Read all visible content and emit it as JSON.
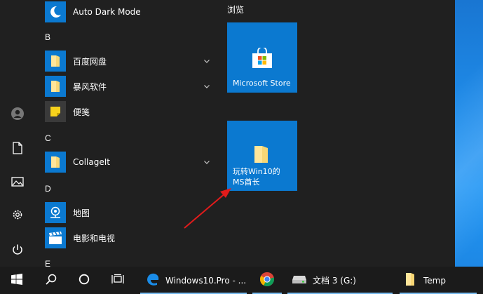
{
  "start_menu": {
    "apps": [
      {
        "type": "app",
        "label": "Auto Dark Mode",
        "icon": "moon-icon"
      },
      {
        "type": "letter",
        "label": "B"
      },
      {
        "type": "app",
        "label": "百度网盘",
        "icon": "folder-icon",
        "expandable": true
      },
      {
        "type": "app",
        "label": "暴风软件",
        "icon": "folder-icon",
        "expandable": true
      },
      {
        "type": "app",
        "label": "便笺",
        "icon": "sticky-note-icon"
      },
      {
        "type": "letter",
        "label": "C"
      },
      {
        "type": "app",
        "label": "CollageIt",
        "icon": "folder-icon",
        "expandable": true
      },
      {
        "type": "letter",
        "label": "D"
      },
      {
        "type": "app",
        "label": "地图",
        "icon": "maps-icon"
      },
      {
        "type": "app",
        "label": "电影和电视",
        "icon": "movies-icon"
      },
      {
        "type": "letter",
        "label": "E"
      }
    ],
    "tiles_group_title": "浏览",
    "tiles": [
      {
        "label_lines": [
          "Microsoft Store"
        ],
        "icon": "store-icon"
      },
      {
        "label_lines": [
          "玩转Win10的",
          "MS酋长"
        ],
        "icon": "folder-icon"
      }
    ],
    "rail": [
      "user-icon",
      "document-icon",
      "pictures-icon",
      "settings-icon",
      "power-icon"
    ]
  },
  "taskbar": {
    "start_icon": "windows-logo-icon",
    "search_icon": "search-icon",
    "cortana_icon": "cortana-icon",
    "taskview_icon": "task-view-icon",
    "apps": [
      {
        "label": "Windows10.Pro - ...",
        "icon": "edge-icon"
      },
      {
        "label": "",
        "icon": "chrome-icon"
      },
      {
        "label": "文档 3 (G:)",
        "icon": "drive-icon"
      },
      {
        "label": "Temp",
        "icon": "folder-icon"
      }
    ]
  },
  "colors": {
    "tile": "#0b79d0",
    "menu_bg": "#202020",
    "taskbar_bg": "#1b1b1b",
    "annotation_arrow": "#e21b1b",
    "icon_tile": "#0b79d0"
  }
}
